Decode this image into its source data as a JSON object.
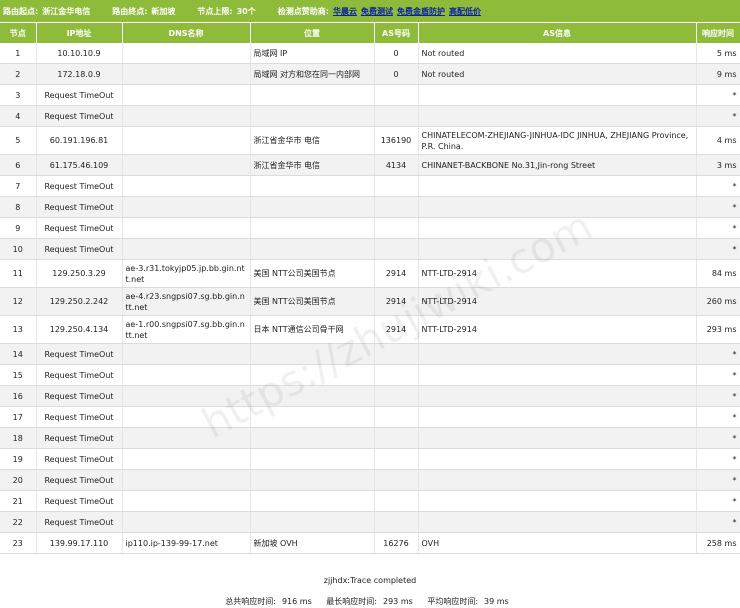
{
  "header": {
    "start_label": "路由起点:",
    "start_value": "浙江金华电信",
    "end_label": "路由终点:",
    "end_value": "新加坡",
    "limit_label": "节点上限:",
    "limit_value": "30个",
    "sponsor_label": "检测点赞助商:",
    "sponsor_name": "华晨云",
    "links": [
      "免费测试",
      "免费金盾防护",
      "高配低价"
    ]
  },
  "columns": [
    "节点",
    "IP地址",
    "DNS名称",
    "位置",
    "AS号码",
    "AS信息",
    "响应时间"
  ],
  "rows": [
    {
      "hop": "1",
      "ip": "10.10.10.9",
      "dns": "",
      "loc": "局域网 IP",
      "asn": "0",
      "asinfo": "Not routed",
      "time": "5 ms"
    },
    {
      "hop": "2",
      "ip": "172.18.0.9",
      "dns": "",
      "loc": "局域网 对方和您在同一内部网",
      "asn": "0",
      "asinfo": "Not routed",
      "time": "9 ms"
    },
    {
      "hop": "3",
      "ip": "Request TimeOut",
      "dns": "",
      "loc": "",
      "asn": "",
      "asinfo": "",
      "time": "*"
    },
    {
      "hop": "4",
      "ip": "Request TimeOut",
      "dns": "",
      "loc": "",
      "asn": "",
      "asinfo": "",
      "time": "*"
    },
    {
      "hop": "5",
      "ip": "60.191.196.81",
      "dns": "",
      "loc": "浙江省金华市 电信",
      "asn": "136190",
      "asinfo": "CHINATELECOM-ZHEJIANG-JINHUA-IDC JINHUA, ZHEJIANG Province, P.R. China.",
      "time": "4 ms"
    },
    {
      "hop": "6",
      "ip": "61.175.46.109",
      "dns": "",
      "loc": "浙江省金华市 电信",
      "asn": "4134",
      "asinfo": "CHINANET-BACKBONE No.31,Jin-rong Street",
      "time": "3 ms"
    },
    {
      "hop": "7",
      "ip": "Request TimeOut",
      "dns": "",
      "loc": "",
      "asn": "",
      "asinfo": "",
      "time": "*"
    },
    {
      "hop": "8",
      "ip": "Request TimeOut",
      "dns": "",
      "loc": "",
      "asn": "",
      "asinfo": "",
      "time": "*"
    },
    {
      "hop": "9",
      "ip": "Request TimeOut",
      "dns": "",
      "loc": "",
      "asn": "",
      "asinfo": "",
      "time": "*"
    },
    {
      "hop": "10",
      "ip": "Request TimeOut",
      "dns": "",
      "loc": "",
      "asn": "",
      "asinfo": "",
      "time": "*"
    },
    {
      "hop": "11",
      "ip": "129.250.3.29",
      "dns": "ae-3.r31.tokyjp05.jp.bb.gin.ntt.net",
      "loc": "美国 NTT公司美国节点",
      "asn": "2914",
      "asinfo": "NTT-LTD-2914",
      "time": "84 ms"
    },
    {
      "hop": "12",
      "ip": "129.250.2.242",
      "dns": "ae-4.r23.sngpsi07.sg.bb.gin.ntt.net",
      "loc": "美国 NTT公司美国节点",
      "asn": "2914",
      "asinfo": "NTT-LTD-2914",
      "time": "260 ms"
    },
    {
      "hop": "13",
      "ip": "129.250.4.134",
      "dns": "ae-1.r00.sngpsi07.sg.bb.gin.ntt.net",
      "loc": "日本 NTT通信公司骨干网",
      "asn": "2914",
      "asinfo": "NTT-LTD-2914",
      "time": "293 ms"
    },
    {
      "hop": "14",
      "ip": "Request TimeOut",
      "dns": "",
      "loc": "",
      "asn": "",
      "asinfo": "",
      "time": "*"
    },
    {
      "hop": "15",
      "ip": "Request TimeOut",
      "dns": "",
      "loc": "",
      "asn": "",
      "asinfo": "",
      "time": "*"
    },
    {
      "hop": "16",
      "ip": "Request TimeOut",
      "dns": "",
      "loc": "",
      "asn": "",
      "asinfo": "",
      "time": "*"
    },
    {
      "hop": "17",
      "ip": "Request TimeOut",
      "dns": "",
      "loc": "",
      "asn": "",
      "asinfo": "",
      "time": "*"
    },
    {
      "hop": "18",
      "ip": "Request TimeOut",
      "dns": "",
      "loc": "",
      "asn": "",
      "asinfo": "",
      "time": "*"
    },
    {
      "hop": "19",
      "ip": "Request TimeOut",
      "dns": "",
      "loc": "",
      "asn": "",
      "asinfo": "",
      "time": "*"
    },
    {
      "hop": "20",
      "ip": "Request TimeOut",
      "dns": "",
      "loc": "",
      "asn": "",
      "asinfo": "",
      "time": "*"
    },
    {
      "hop": "21",
      "ip": "Request TimeOut",
      "dns": "",
      "loc": "",
      "asn": "",
      "asinfo": "",
      "time": "*"
    },
    {
      "hop": "22",
      "ip": "Request TimeOut",
      "dns": "",
      "loc": "",
      "asn": "",
      "asinfo": "",
      "time": "*"
    },
    {
      "hop": "23",
      "ip": "139.99.17.110",
      "dns": "ip110.ip-139-99-17.net",
      "loc": "新加坡 OVH",
      "asn": "16276",
      "asinfo": "OVH",
      "time": "258 ms"
    }
  ],
  "footer": {
    "completed": "zjjhdx:Trace completed",
    "total_label": "总共响应时间:",
    "total_value": "916 ms",
    "max_label": "最长响应时间:",
    "max_value": "293 ms",
    "avg_label": "平均响应时间:",
    "avg_value": "39 ms"
  },
  "watermark": "https://zhujiwiki.com",
  "colors": {
    "header_bg": "#8fbb3a",
    "sponsor": "#1b2ea8"
  }
}
